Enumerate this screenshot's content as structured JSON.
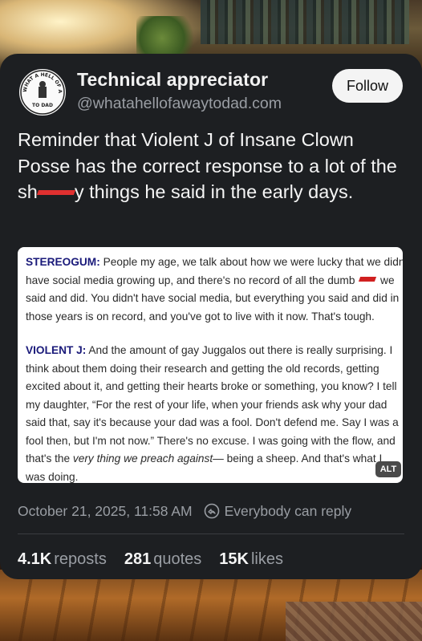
{
  "post": {
    "author_name": "Technical appreciator",
    "author_handle": "@whatahellofawaytodad.com",
    "avatar_text_top": "WHAT A HELL OF A WAY",
    "avatar_text_bottom": "TO DAD",
    "follow_label": "Follow",
    "text_part1": "Reminder that Violent J of Insane Clown Posse has the correct response to a lot of the sh",
    "text_part2": "y things he said in the early days.",
    "timestamp": "October 21, 2025, 11:58 AM",
    "reply_setting": "Everybody can reply",
    "alt_label": "ALT"
  },
  "quote_image": {
    "para1": {
      "speaker": "STEREOGUM:",
      "lines": [
        " People my age, we talk about how we were lucky that we didn't",
        "have social media growing up, and there's no record of all the dumb ",
        "said and did. You didn't have social media, but everything you said and did in",
        "those years is on record, and you've got to live with it now. That's tough."
      ],
      "after_redact": " we"
    },
    "para2": {
      "speaker": "VIOLENT J:",
      "lines": [
        " And the amount of gay Juggalos out there is really surprising. I",
        "think about them doing their research and getting the old records, getting",
        "excited about it, and getting their hearts broke or something, you know? I tell",
        "my daughter, “For the rest of your life, when your friends ask why your dad",
        "said that, say it's because your dad was a fool. Don't defend me. Say I was a",
        "fool then, but I'm not now.” There's no excuse. I was going with the flow, and",
        "that's the ",
        "very thing we preach against",
        "— being a sheep. And that's what I",
        "was doing."
      ]
    }
  },
  "stats": [
    {
      "count": "4.1K",
      "label": "reposts"
    },
    {
      "count": "281",
      "label": "quotes"
    },
    {
      "count": "15K",
      "label": "likes"
    }
  ],
  "colors": {
    "card_bg": "#1d1f22",
    "text_primary": "#f5f5f5",
    "text_secondary": "#9a9ea4",
    "redaction": "#e03030"
  }
}
